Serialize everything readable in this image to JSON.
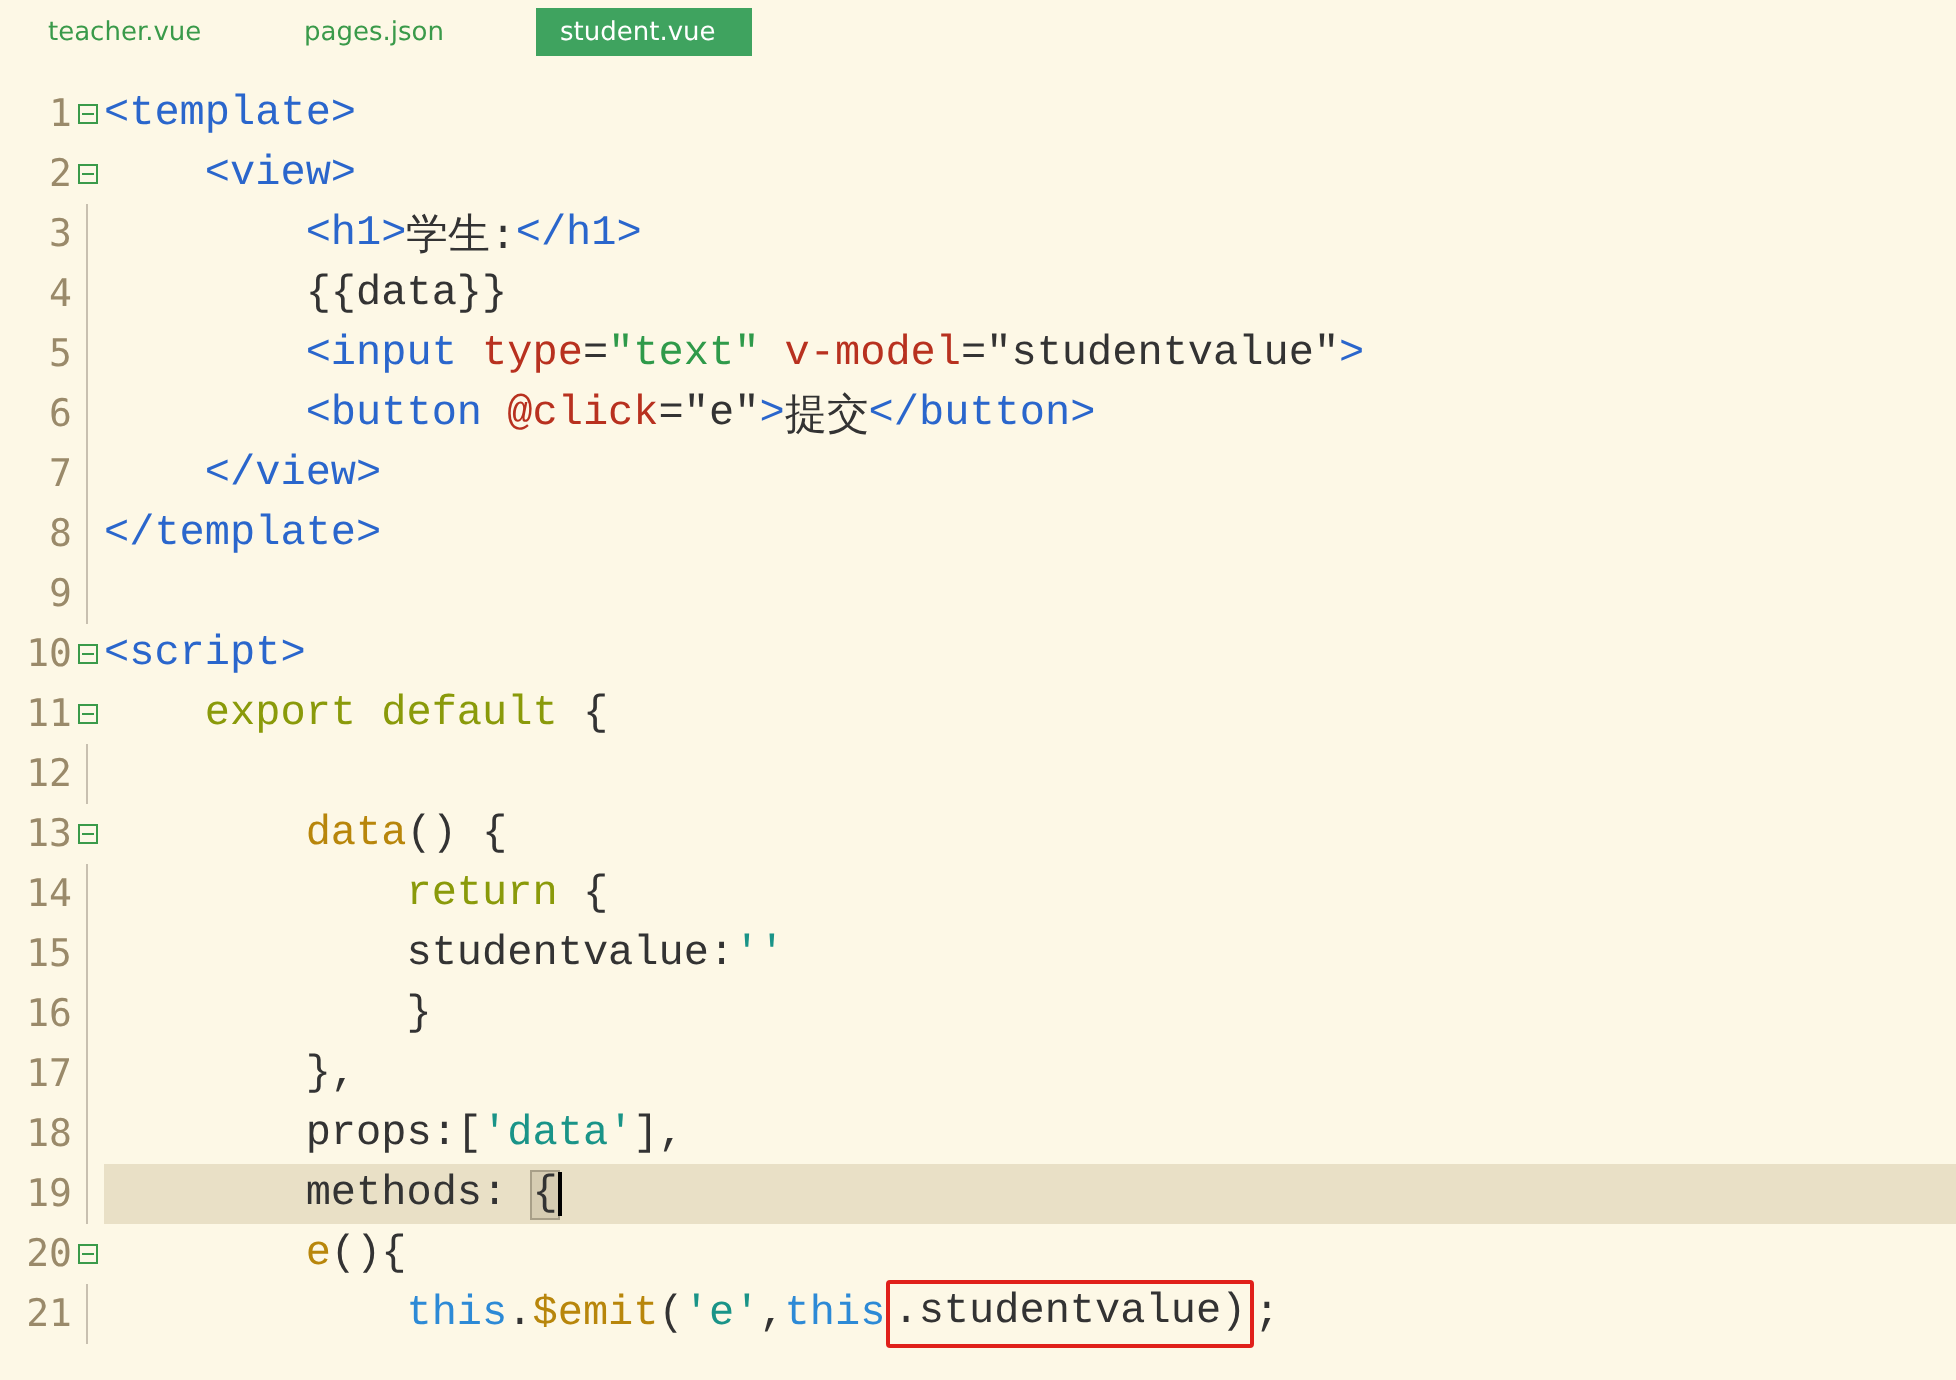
{
  "tabs": [
    {
      "label": "teacher.vue",
      "selected": false
    },
    {
      "label": "pages.json",
      "selected": false
    },
    {
      "label": "student.vue",
      "selected": true
    }
  ],
  "lines": [
    {
      "number": "1",
      "collapsible": true,
      "current": false,
      "tokens": [
        {
          "text": "<template>",
          "kind": "tag"
        }
      ]
    },
    {
      "number": "2",
      "collapsible": true,
      "current": false,
      "tokens": [
        {
          "text": "    <view>",
          "kind": "tag"
        }
      ]
    },
    {
      "number": "3",
      "collapsible": false,
      "current": false,
      "tokens": [
        {
          "text": "        <h1>",
          "kind": "tag"
        },
        {
          "text": "学生:",
          "kind": "plain"
        },
        {
          "text": "</h1>",
          "kind": "tag"
        }
      ]
    },
    {
      "number": "4",
      "collapsible": false,
      "current": false,
      "tokens": [
        {
          "text": "        {{data}}",
          "kind": "plain"
        }
      ]
    },
    {
      "number": "5",
      "collapsible": false,
      "current": false,
      "tokens": [
        {
          "text": "        <input ",
          "kind": "tag"
        },
        {
          "text": "type",
          "kind": "attr"
        },
        {
          "text": "=",
          "kind": "plain"
        },
        {
          "text": "\"text\"",
          "kind": "string"
        },
        {
          "text": " v-model",
          "kind": "attr"
        },
        {
          "text": "=\"studentvalue\"",
          "kind": "plain"
        },
        {
          "text": ">",
          "kind": "tag"
        }
      ]
    },
    {
      "number": "6",
      "collapsible": false,
      "current": false,
      "tokens": [
        {
          "text": "        <button ",
          "kind": "tag"
        },
        {
          "text": "@click",
          "kind": "attr"
        },
        {
          "text": "=\"e\"",
          "kind": "plain"
        },
        {
          "text": ">",
          "kind": "tag"
        },
        {
          "text": "提交",
          "kind": "plain"
        },
        {
          "text": "</button>",
          "kind": "tag"
        }
      ]
    },
    {
      "number": "7",
      "collapsible": false,
      "current": false,
      "tokens": [
        {
          "text": "    </view>",
          "kind": "tag"
        }
      ]
    },
    {
      "number": "8",
      "collapsible": false,
      "current": false,
      "tokens": [
        {
          "text": "</template>",
          "kind": "tag"
        }
      ]
    },
    {
      "number": "9",
      "collapsible": false,
      "current": false
    },
    {
      "number": "10",
      "collapsible": true,
      "current": false,
      "tokens": [
        {
          "text": "<script>",
          "kind": "tag"
        }
      ]
    },
    {
      "number": "11",
      "collapsible": true,
      "current": false,
      "tokens": [
        {
          "text": "    export default",
          "kind": "keyword"
        },
        {
          "text": " {",
          "kind": "plain"
        }
      ]
    },
    {
      "number": "12",
      "collapsible": false,
      "current": false
    },
    {
      "number": "13",
      "collapsible": true,
      "current": false,
      "tokens": [
        {
          "text": "        data",
          "kind": "func"
        },
        {
          "text": "() {",
          "kind": "plain"
        }
      ]
    },
    {
      "number": "14",
      "collapsible": false,
      "current": false,
      "tokens": [
        {
          "text": "            return",
          "kind": "keyword"
        },
        {
          "text": " {",
          "kind": "plain"
        }
      ]
    },
    {
      "number": "15",
      "collapsible": false,
      "current": false,
      "tokens": [
        {
          "text": "            studentvalue:",
          "kind": "plain"
        },
        {
          "text": "''",
          "kind": "quote"
        }
      ]
    },
    {
      "number": "16",
      "collapsible": false,
      "current": false,
      "tokens": [
        {
          "text": "            }",
          "kind": "plain"
        }
      ]
    },
    {
      "number": "17",
      "collapsible": false,
      "current": false,
      "tokens": [
        {
          "text": "        },",
          "kind": "plain"
        }
      ]
    },
    {
      "number": "18",
      "collapsible": false,
      "current": false,
      "tokens": [
        {
          "text": "        props:[",
          "kind": "plain"
        },
        {
          "text": "'data'",
          "kind": "quote"
        },
        {
          "text": "],",
          "kind": "plain"
        }
      ]
    },
    {
      "number": "19",
      "collapsible": false,
      "current": true,
      "tokens": [
        {
          "text": "        methods: ",
          "kind": "plain"
        },
        {
          "text": "{",
          "kind": "bracket"
        }
      ]
    },
    {
      "number": "20",
      "collapsible": true,
      "current": false,
      "tokens": [
        {
          "text": "        e",
          "kind": "func"
        },
        {
          "text": "(){",
          "kind": "plain"
        }
      ]
    },
    {
      "number": "21",
      "collapsible": false,
      "current": false,
      "tokens": [
        {
          "text": "            this",
          "kind": "this"
        },
        {
          "text": ".",
          "kind": "plain"
        },
        {
          "text": "$emit",
          "kind": "func"
        },
        {
          "text": "(",
          "kind": "plain"
        },
        {
          "text": "'e'",
          "kind": "quote"
        },
        {
          "text": ",",
          "kind": "plain"
        },
        {
          "text": "this",
          "kind": "this"
        },
        {
          "text": ".studentvalue)",
          "kind": "plain",
          "boxed": true
        },
        {
          "text": ";",
          "kind": "plain"
        }
      ]
    }
  ]
}
